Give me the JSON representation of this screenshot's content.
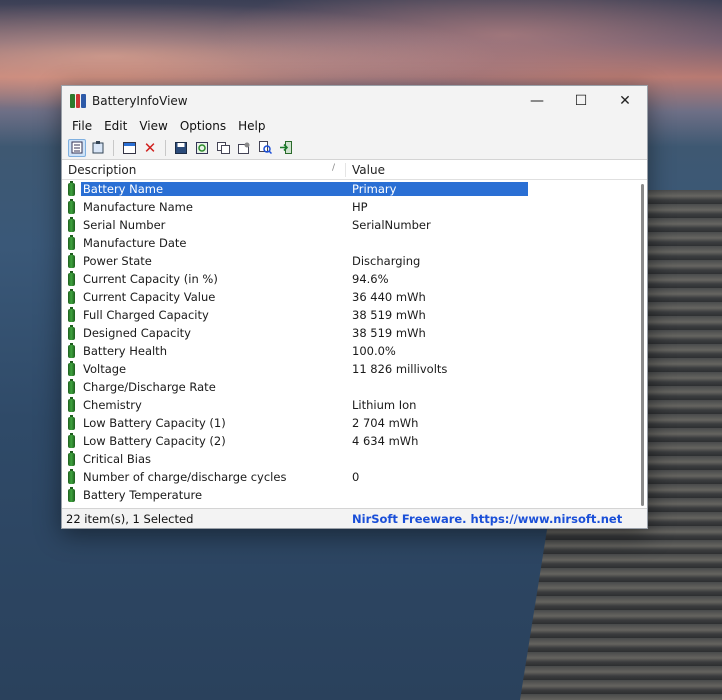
{
  "window": {
    "title": "BatteryInfoView",
    "minimize": "—",
    "maximize": "☐",
    "close": "✕"
  },
  "menu": [
    "File",
    "Edit",
    "View",
    "Options",
    "Help"
  ],
  "toolbar_icons": [
    "html-report-icon",
    "clipboard-icon",
    "properties-icon",
    "delete-icon",
    "save-icon",
    "refresh-icon",
    "copy-icon",
    "options-icon",
    "find-icon",
    "exit-icon"
  ],
  "list": {
    "headers": {
      "description": "Description",
      "value": "Value"
    },
    "rows": [
      {
        "description": "Battery Name",
        "value": "Primary",
        "selected": true
      },
      {
        "description": "Manufacture Name",
        "value": "HP"
      },
      {
        "description": "Serial Number",
        "value": "SerialNumber"
      },
      {
        "description": "Manufacture Date",
        "value": ""
      },
      {
        "description": "Power State",
        "value": "Discharging"
      },
      {
        "description": "Current Capacity (in %)",
        "value": "94.6%"
      },
      {
        "description": "Current Capacity Value",
        "value": "36 440 mWh"
      },
      {
        "description": "Full Charged Capacity",
        "value": "38 519 mWh"
      },
      {
        "description": "Designed Capacity",
        "value": "38 519 mWh"
      },
      {
        "description": "Battery Health",
        "value": "100.0%"
      },
      {
        "description": "Voltage",
        "value": "11 826 millivolts"
      },
      {
        "description": "Charge/Discharge Rate",
        "value": ""
      },
      {
        "description": "Chemistry",
        "value": "Lithium Ion"
      },
      {
        "description": "Low Battery Capacity (1)",
        "value": "2 704 mWh"
      },
      {
        "description": "Low Battery Capacity (2)",
        "value": "4 634 mWh"
      },
      {
        "description": "Critical Bias",
        "value": ""
      },
      {
        "description": "Number of charge/discharge cycles",
        "value": "0"
      },
      {
        "description": "Battery Temperature",
        "value": ""
      }
    ]
  },
  "status": {
    "items": "22 item(s), 1 Selected",
    "link": "NirSoft Freeware. https://www.nirsoft.net"
  },
  "colors": {
    "selection": "#2a6fd4",
    "link": "#1a4fd8",
    "battery_icon": "#3fa53f"
  }
}
